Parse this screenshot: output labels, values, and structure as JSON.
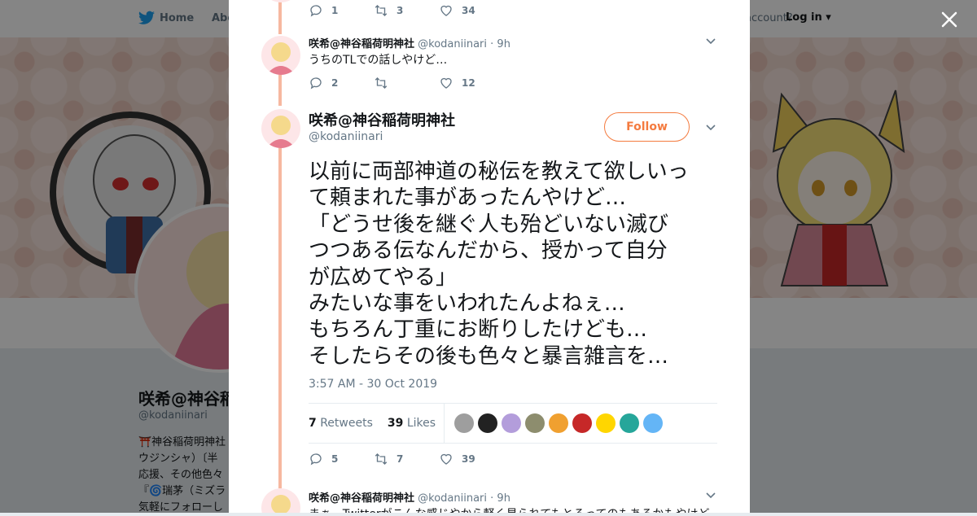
{
  "nav": {
    "home_label": "Home",
    "about_label": "Abo",
    "account_text": "account?",
    "login_label": "Log in"
  },
  "profile": {
    "name": "咲希@神谷稲荷",
    "handle": "@kodaniinari",
    "bio_lines": [
      "⛩️神谷稲荷明神社",
      "ウジンシャ）〔半",
      "応援、その他色々",
      "『🌀瑞茅（ミズラ",
      "気軽にフォローし"
    ]
  },
  "tweets": {
    "top": {
      "reply_count": "1",
      "retweet_count": "3",
      "like_count": "34"
    },
    "second": {
      "name": "咲希@神谷稲荷明神社",
      "handle": "@kodaniinari",
      "time": "· 9h",
      "text": "うちのTLでの話しやけど…",
      "reply_count": "2",
      "retweet_count": "",
      "like_count": "12"
    },
    "main": {
      "name": "咲希@神谷稲荷明神社",
      "handle": "@kodaniinari",
      "follow_label": "Follow",
      "text_lines": [
        "以前に両部神道の秘伝を教えて欲しいっ",
        "て頼まれた事があったんやけど…",
        "「どうせ後を継ぐ人も殆どいない滅び",
        "つつある伝なんだから、授かって自分",
        "が広めてやる」",
        "みたいな事をいわれたんよねぇ…",
        "もちろん丁重にお断りしたけども…",
        "そしたらその後も色々と暴言雑言を…"
      ],
      "timestamp": "3:57 AM - 30 Oct 2019",
      "retweets_count": "7",
      "retweets_label": "Retweets",
      "likes_count": "39",
      "likes_label": "Likes",
      "reply_count": "5",
      "retweet_count": "7",
      "like_count": "39"
    },
    "next": {
      "name": "咲希@神谷稲荷明神社",
      "handle": "@kodaniinari",
      "time": "· 9h",
      "text": "まぁ、Twitterがこんな感じやから軽く見られてもとるってのもあるかもやけど"
    }
  },
  "colors": {
    "accent": "#f47b3f",
    "thread": "#f6b8a0",
    "muted": "#657786",
    "twitter_blue": "#1da1f2"
  },
  "liker_avatars": [
    "#9e9e9e",
    "#222222",
    "#b39ddb",
    "#8d8d6e",
    "#f0a030",
    "#c62828",
    "#ffd600",
    "#26a69a",
    "#64b5f6"
  ]
}
